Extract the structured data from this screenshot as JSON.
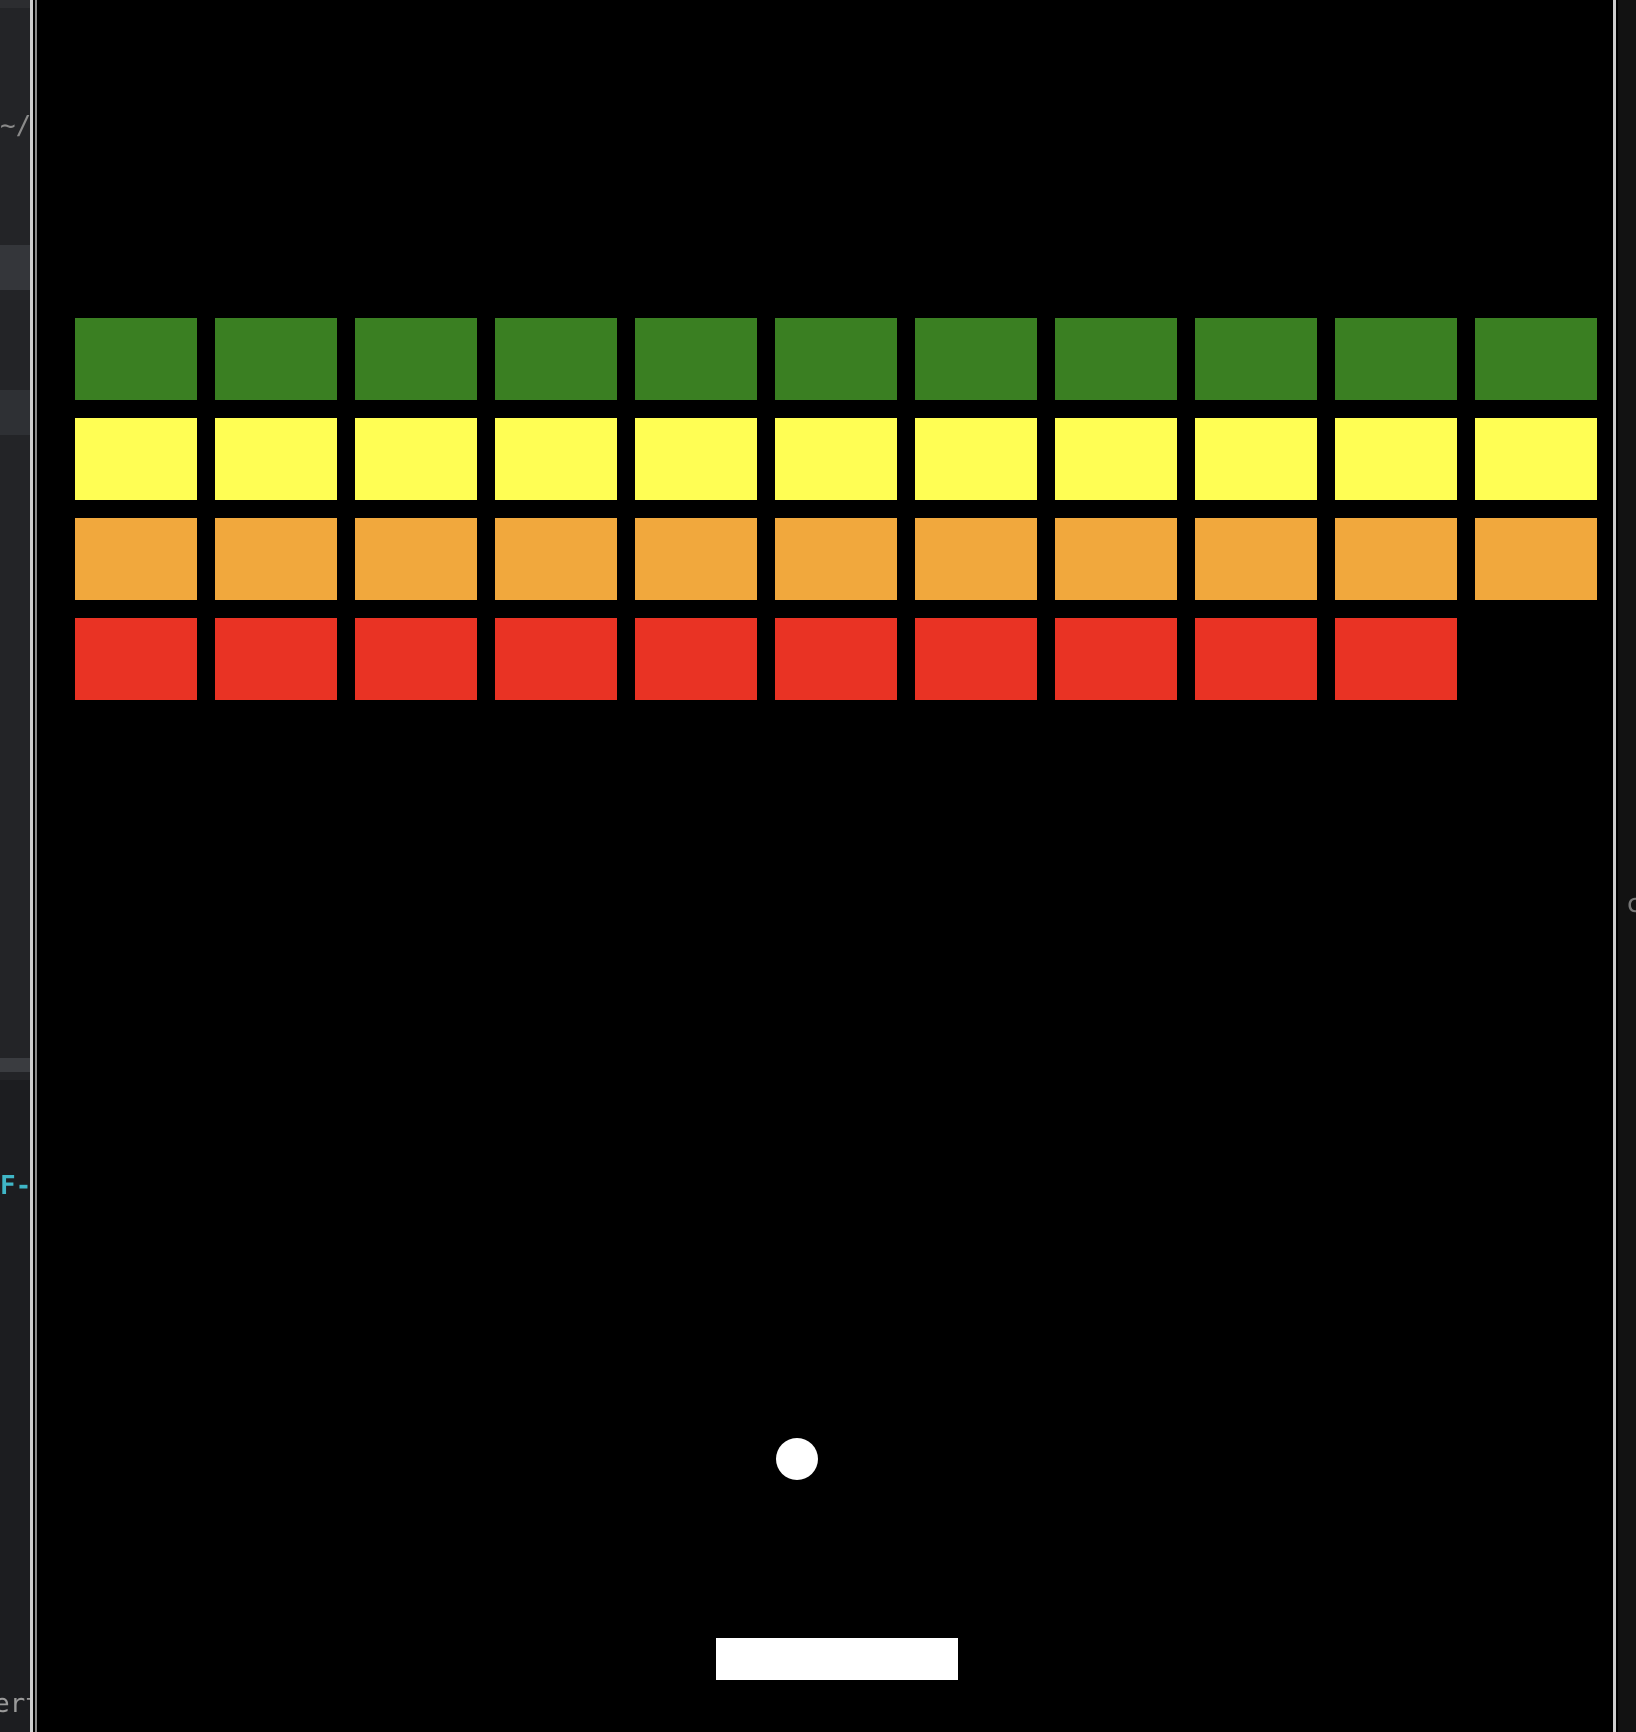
{
  "left_panel": {
    "path_fragment": "~/",
    "code_fragment": "F-",
    "bottom_fragment": "ert"
  },
  "right_panel": {
    "glyph_fragment": "c"
  },
  "game": {
    "name": "breakout",
    "background_color": "#000000",
    "paddle_color": "#ffffff",
    "ball_color": "#ffffff",
    "brick_rows": [
      {
        "color_name": "green",
        "color": "#3a7f22",
        "bricks_present": [
          1,
          1,
          1,
          1,
          1,
          1,
          1,
          1,
          1,
          1,
          1
        ]
      },
      {
        "color_name": "yellow",
        "color": "#fffe54",
        "bricks_present": [
          1,
          1,
          1,
          1,
          1,
          1,
          1,
          1,
          1,
          1,
          1
        ]
      },
      {
        "color_name": "orange",
        "color": "#f1a83d",
        "bricks_present": [
          1,
          1,
          1,
          1,
          1,
          1,
          1,
          1,
          1,
          1,
          1
        ]
      },
      {
        "color_name": "red",
        "color": "#e93324",
        "bricks_present": [
          1,
          1,
          1,
          1,
          1,
          1,
          1,
          1,
          1,
          1,
          0
        ]
      }
    ]
  }
}
